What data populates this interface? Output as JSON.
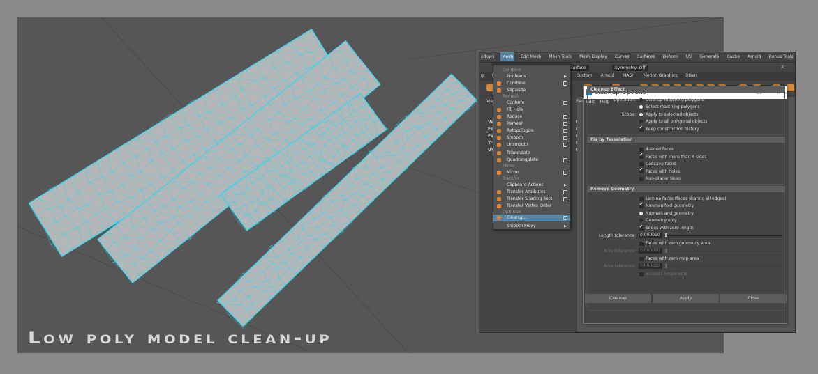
{
  "caption": "Low poly model clean-up",
  "colors": {
    "wireframe": "#33d6f0",
    "mesh": "#b6b6b6",
    "highlight": "#5285a6",
    "viewport": "#565656"
  },
  "menubar": [
    "ndows",
    "Mesh",
    "Edit Mesh",
    "Mesh Tools",
    "Mesh Display",
    "Curves",
    "Surfaces",
    "Deform",
    "UV",
    "Generate",
    "Cache",
    "Arnold",
    "Bonus Tools",
    "Help"
  ],
  "menubar_active": "Mesh",
  "toolbar": {
    "live_surface": "o Live Surface",
    "symmetry": "Symmetry: Off",
    "x_label": "X:"
  },
  "shelf_tabs": [
    "g",
    "UV",
    "ndering",
    "FX",
    "FX Caching",
    "Custom",
    "Arnold",
    "MASH",
    "Motion Graphics",
    "XGen"
  ],
  "left_panel": {
    "view": "View",
    "rows": [
      "Vert",
      "Edg",
      "Fac",
      "Tris",
      "UVs"
    ],
    "values": [
      "0",
      "0",
      "0",
      "0",
      "0"
    ],
    "panel": "Pan"
  },
  "mesh_menu": [
    {
      "label": "Combine",
      "type": "section"
    },
    {
      "label": "Booleans",
      "sub": true
    },
    {
      "label": "Combine",
      "icon": true,
      "opt": true
    },
    {
      "label": "Separate",
      "icon": true
    },
    {
      "label": "Remesh",
      "type": "section"
    },
    {
      "label": "Conform",
      "opt": true
    },
    {
      "label": "Fill Hole",
      "icon": true
    },
    {
      "label": "Reduce",
      "icon": true,
      "opt": true
    },
    {
      "label": "Remesh",
      "icon": true,
      "opt": true
    },
    {
      "label": "Retopologize",
      "icon": true,
      "opt": true
    },
    {
      "label": "Smooth",
      "icon": true,
      "opt": true
    },
    {
      "label": "Unsmooth",
      "icon": true,
      "opt": true
    },
    {
      "label": "Triangulate",
      "icon": true
    },
    {
      "label": "Quadrangulate",
      "icon": true,
      "opt": true
    },
    {
      "label": "Mirror",
      "type": "section"
    },
    {
      "label": "Mirror",
      "icon": true,
      "opt": true
    },
    {
      "label": "Transfer",
      "type": "section"
    },
    {
      "label": "Clipboard Actions",
      "sub": true
    },
    {
      "label": "Transfer Attributes",
      "icon": true,
      "opt": true
    },
    {
      "label": "Transfer Shading Sets",
      "icon": true,
      "opt": true
    },
    {
      "label": "Transfer Vertex Order",
      "icon": true
    },
    {
      "label": "Optimize",
      "type": "section"
    },
    {
      "label": "Cleanup...",
      "icon": true,
      "opt": true,
      "selected": true
    },
    {
      "label": "Smooth Proxy",
      "sub": true
    }
  ],
  "dialog": {
    "title": "Cleanup Options",
    "menu": [
      "Edit",
      "Help"
    ],
    "window_controls": [
      "—",
      "☐",
      "✕"
    ],
    "sections": {
      "effect": "Cleanup Effect",
      "tessellation": "Fix by Tesselation",
      "remove": "Remove Geometry"
    },
    "operation_label": "Operation:",
    "operation": [
      {
        "label": "Cleanup matching polygons",
        "on": false
      },
      {
        "label": "Select matching polygons",
        "on": true
      }
    ],
    "scope_label": "Scope:",
    "scope": [
      {
        "label": "Apply to selected objects",
        "on": true
      },
      {
        "label": "Apply to all polygonal objects",
        "on": false
      }
    ],
    "keep_history": {
      "label": "Keep construction history",
      "on": true
    },
    "tess": [
      {
        "label": "4-sided faces",
        "on": false
      },
      {
        "label": "Faces with more than 4 sides",
        "on": true
      },
      {
        "label": "Concave faces",
        "on": false
      },
      {
        "label": "Faces with holes",
        "on": true
      },
      {
        "label": "Non-planar faces",
        "on": false
      }
    ],
    "lamina": {
      "label": "Lamina faces (faces sharing all edges)",
      "on": false
    },
    "nonmanifold": {
      "label": "Nonmanifold geometry",
      "on": true
    },
    "nm_mode": [
      {
        "label": "Normals and geometry",
        "on": true
      },
      {
        "label": "Geometry only",
        "on": false
      }
    ],
    "zero_edges": {
      "label": "Edges with zero length",
      "on": true
    },
    "length_tol": {
      "label": "Length tolerance:",
      "value": "0.000010"
    },
    "zero_geo": {
      "label": "Faces with zero geometry area",
      "on": false
    },
    "area_tol1": {
      "label": "Area tolerance:",
      "value": "0.000010"
    },
    "zero_map": {
      "label": "Faces with zero map area",
      "on": false
    },
    "area_tol2": {
      "label": "Area tolerance:",
      "value": "0.000010"
    },
    "invalid": {
      "label": "Invalid Components",
      "on": false
    },
    "buttons": [
      "Cleanup",
      "Apply",
      "Close"
    ]
  }
}
